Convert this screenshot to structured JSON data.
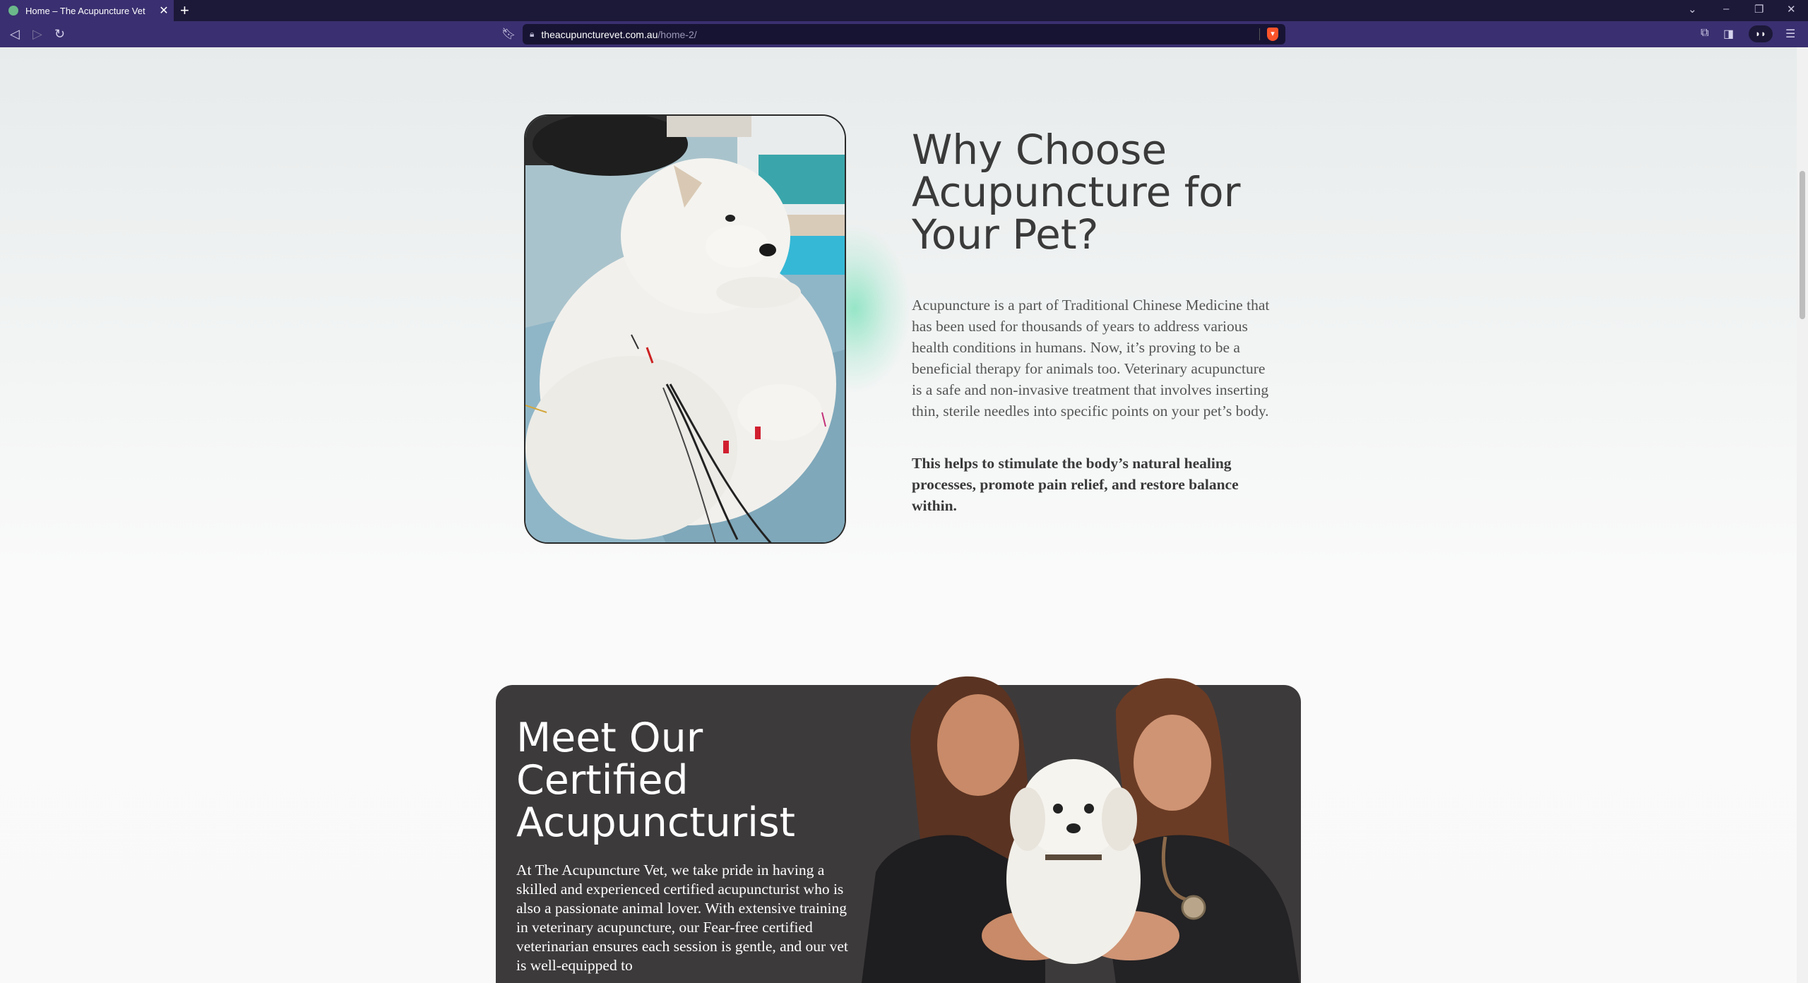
{
  "browser": {
    "tab_title": "Home – The Acupuncture Vet",
    "tab_close": "✕",
    "new_tab": "+",
    "url_host": "theacupuncturevet.com.au",
    "url_path": "/home-2/",
    "window_controls": [
      "⌄",
      "–",
      "❐",
      "✕"
    ],
    "icons": [
      "back-icon",
      "forward-icon",
      "reload-icon",
      "bookmark-icon",
      "lock-icon",
      "brave-shield-icon",
      "extensions-icon",
      "sidebar-icon",
      "wallet-icon",
      "menu-icon"
    ]
  },
  "why": {
    "title": "Why Choose Acupuncture for Your Pet?",
    "body": "Acupuncture is a part of Traditional Chinese Medicine that has been used for thousands of years to address various health conditions in humans. Now, it’s proving to be a beneficial therapy for animals too. Veterinary acupuncture is a safe and non-invasive treatment that involves inserting thin, sterile needles into specific points on your pet’s body.",
    "bold": "This helps to stimulate the body’s natural healing processes, promote pain relief, and restore balance within."
  },
  "meet": {
    "title": "Meet Our Certified Acupuncturist",
    "body": "At The Acupuncture Vet, we take pride in having a skilled and experienced certified acupuncturist who is also a passionate animal lover. With extensive training in veterinary acupuncture, our Fear-free certified veterinarian ensures each session is gentle, and our vet is well-equipped to"
  },
  "colors": {
    "tab_bar": "#1c1838",
    "toolbar": "#3a2f70",
    "heading": "#3a3a3a",
    "body_text": "#555555",
    "card_bg": "#3d3a3b",
    "glow": "#78e1b9"
  }
}
